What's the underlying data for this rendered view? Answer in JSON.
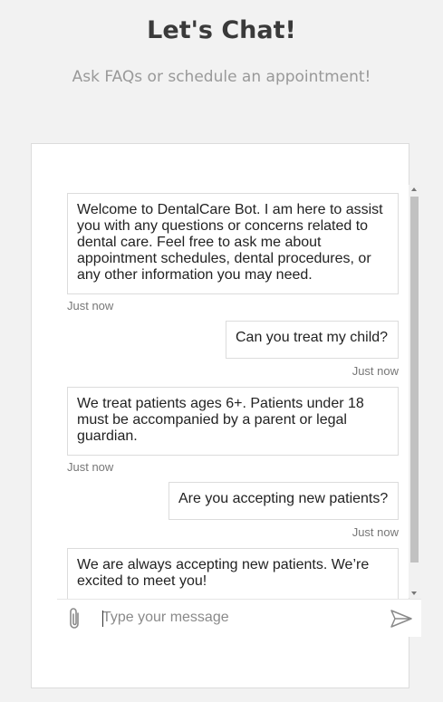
{
  "header": {
    "title": "Let's Chat!",
    "subtitle": "Ask FAQs or schedule an appointment!"
  },
  "messages": [
    {
      "sender": "bot",
      "text": "Welcome to DentalCare Bot. I am here to assist you with any questions or concerns related to dental care. Feel free to ask me about appointment schedules, dental procedures, or any other information you may need.",
      "time": "Just now"
    },
    {
      "sender": "user",
      "text": "Can you treat my child?",
      "time": "Just now"
    },
    {
      "sender": "bot",
      "text": "We treat patients ages 6+. Patients under 18 must be accompanied by a parent or legal guardian.",
      "time": "Just now"
    },
    {
      "sender": "user",
      "text": "Are you accepting new patients?",
      "time": "Just now"
    },
    {
      "sender": "bot",
      "text": "We are always accepting new patients. We’re excited to meet you!",
      "time": ""
    }
  ],
  "composer": {
    "placeholder": "Type your message",
    "attach_icon": "paperclip-icon",
    "send_icon": "send-icon"
  }
}
